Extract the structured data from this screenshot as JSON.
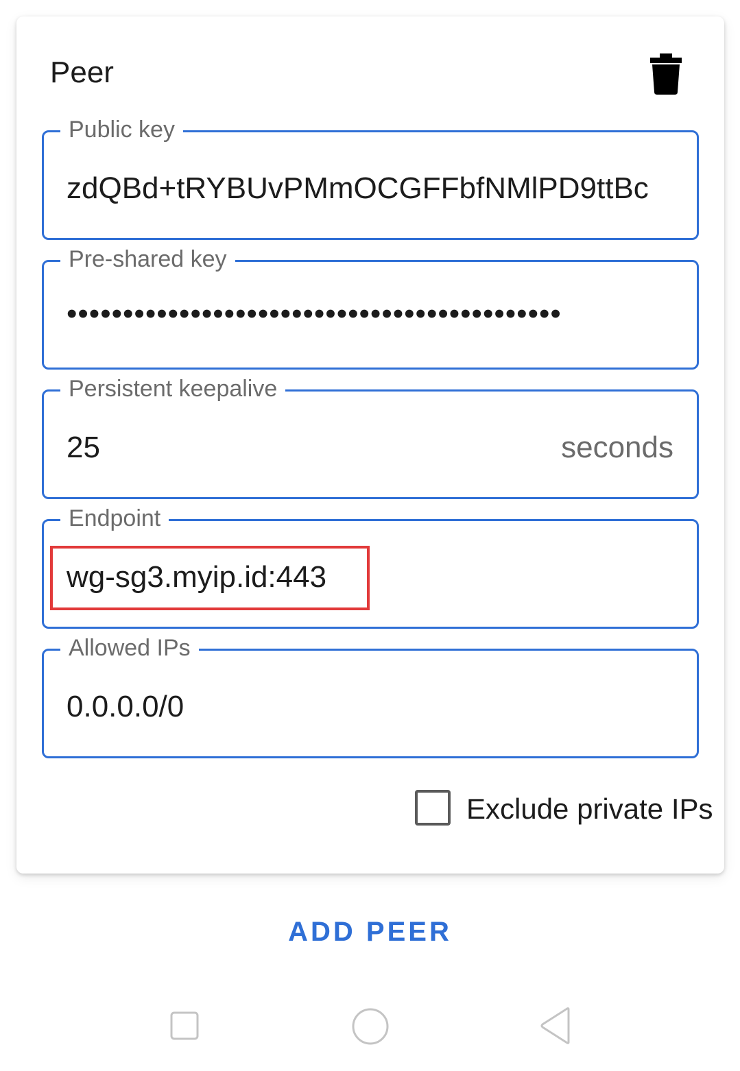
{
  "card": {
    "title": "Peer",
    "delete_icon": "trash-icon"
  },
  "fields": {
    "public_key": {
      "label": "Public key",
      "value": "zdQBd+tRYBUvPMmOCGFFbfNMlPD9ttBc"
    },
    "preshared_key": {
      "label": "Pre-shared key",
      "value": "••••••••••••••••••••••••••••••••••••••••••••"
    },
    "keepalive": {
      "label": "Persistent keepalive",
      "value": "25",
      "suffix": "seconds"
    },
    "endpoint": {
      "label": "Endpoint",
      "value": "wg-sg3.myip.id:443"
    },
    "allowed_ips": {
      "label": "Allowed IPs",
      "value": "0.0.0.0/0"
    }
  },
  "exclude_private": {
    "label": "Exclude private IPs",
    "checked": false
  },
  "actions": {
    "add_peer": "ADD PEER"
  },
  "navbar": {
    "recents_icon": "square-icon",
    "home_icon": "circle-icon",
    "back_icon": "triangle-back-icon"
  },
  "colors": {
    "accent": "#2f6fd6",
    "highlight": "#e23a3a",
    "text": "#1c1c1c",
    "muted": "#6b6b6b"
  }
}
